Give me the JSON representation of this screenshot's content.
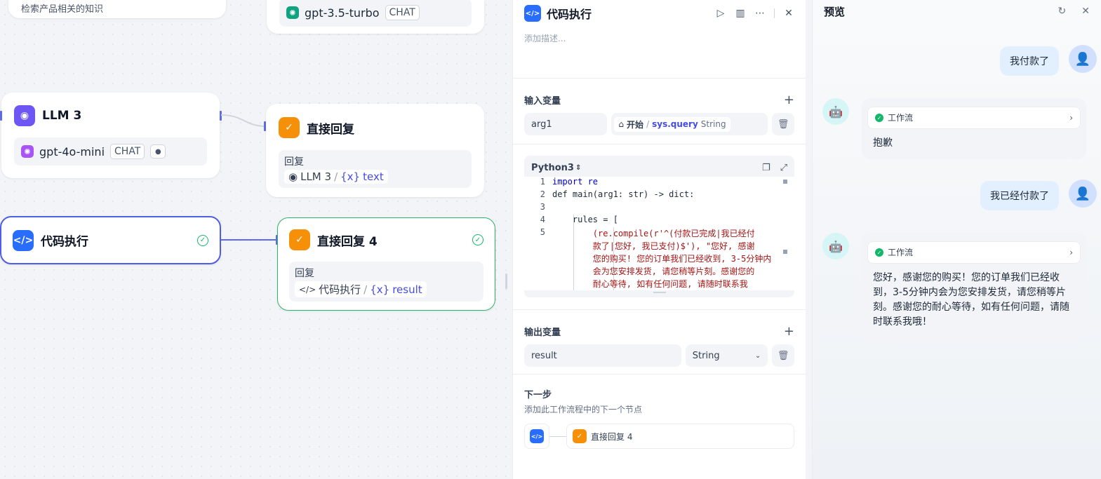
{
  "canvas": {
    "top_left_text": "检索产品相关的知识",
    "node_top_model": {
      "name": "gpt-3.5-turbo",
      "mode": "CHAT"
    },
    "llm3": {
      "title": "LLM 3",
      "model": "gpt-4o-mini",
      "mode": "CHAT"
    },
    "reply1": {
      "title": "直接回复",
      "label": "回复",
      "source": "LLM 3",
      "var": "text"
    },
    "code_node": {
      "title": "代码执行"
    },
    "reply4": {
      "title": "直接回复 4",
      "label": "回复",
      "source": "代码执行",
      "var": "result"
    }
  },
  "panel": {
    "title": "代码执行",
    "description_placeholder": "添加描述...",
    "input_section": "输入变量",
    "input_var": "arg1",
    "input_ref": {
      "node": "开始",
      "var": "sys.query",
      "type": "String"
    },
    "language": "Python3",
    "code_lines": [
      {
        "n": "1",
        "text": "import re"
      },
      {
        "n": "2",
        "text": "def main(arg1: str) -> dict:"
      },
      {
        "n": "3",
        "text": ""
      },
      {
        "n": "4",
        "text": "    rules = ["
      },
      {
        "n": "5",
        "text": "        (re.compile(r'^(付款已完成|我已经付"
      },
      {
        "n": "",
        "text": "        款了|您好, 我已支付)$'), \"您好, 感谢"
      },
      {
        "n": "",
        "text": "        您的购买! 您的订单我们已经收到, 3-5分钟内"
      },
      {
        "n": "",
        "text": "        会为您安排发货, 请您稍等片刻。感谢您的"
      },
      {
        "n": "",
        "text": "        耐心等待, 如有任何问题, 请随时联系我"
      }
    ],
    "output_section": "输出变量",
    "output_var": "result",
    "output_type": "String",
    "next_title": "下一步",
    "next_desc": "添加此工作流程中的下一个节点",
    "next_node": "直接回复 4"
  },
  "preview": {
    "title": "预览",
    "messages": [
      {
        "role": "user",
        "text": "我付款了"
      },
      {
        "role": "bot",
        "workflow": "工作流",
        "text": "抱歉"
      },
      {
        "role": "user",
        "text": "我已经付款了"
      },
      {
        "role": "bot",
        "workflow": "工作流",
        "text": "您好，感谢您的购买！您的订单我们已经收到，3-5分钟内会为您安排发货，请您稍等片刻。感谢您的耐心等待，如有任何问题，请随时联系我哦！"
      }
    ]
  },
  "colors": {
    "accent": "#444ce7",
    "success": "#12b76a",
    "code_icon": "#296dff",
    "reply_icon": "#f79009",
    "llm_icon": "#6e56f5"
  }
}
